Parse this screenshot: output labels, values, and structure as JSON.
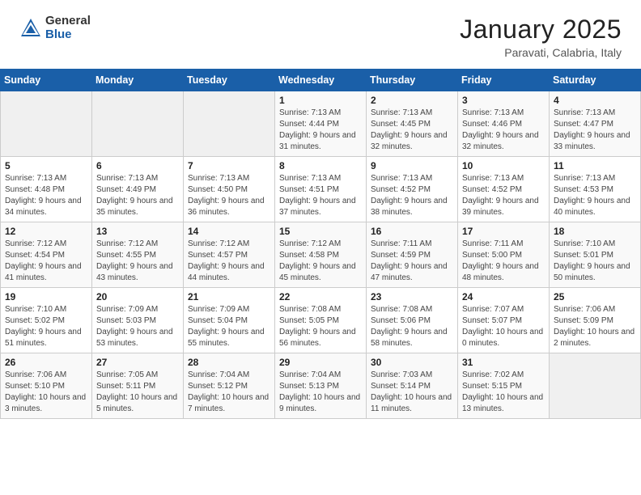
{
  "logo": {
    "general": "General",
    "blue": "Blue"
  },
  "header": {
    "title": "January 2025",
    "subtitle": "Paravati, Calabria, Italy"
  },
  "weekdays": [
    "Sunday",
    "Monday",
    "Tuesday",
    "Wednesday",
    "Thursday",
    "Friday",
    "Saturday"
  ],
  "weeks": [
    [
      {
        "day": "",
        "info": ""
      },
      {
        "day": "",
        "info": ""
      },
      {
        "day": "",
        "info": ""
      },
      {
        "day": "1",
        "info": "Sunrise: 7:13 AM\nSunset: 4:44 PM\nDaylight: 9 hours and 31 minutes."
      },
      {
        "day": "2",
        "info": "Sunrise: 7:13 AM\nSunset: 4:45 PM\nDaylight: 9 hours and 32 minutes."
      },
      {
        "day": "3",
        "info": "Sunrise: 7:13 AM\nSunset: 4:46 PM\nDaylight: 9 hours and 32 minutes."
      },
      {
        "day": "4",
        "info": "Sunrise: 7:13 AM\nSunset: 4:47 PM\nDaylight: 9 hours and 33 minutes."
      }
    ],
    [
      {
        "day": "5",
        "info": "Sunrise: 7:13 AM\nSunset: 4:48 PM\nDaylight: 9 hours and 34 minutes."
      },
      {
        "day": "6",
        "info": "Sunrise: 7:13 AM\nSunset: 4:49 PM\nDaylight: 9 hours and 35 minutes."
      },
      {
        "day": "7",
        "info": "Sunrise: 7:13 AM\nSunset: 4:50 PM\nDaylight: 9 hours and 36 minutes."
      },
      {
        "day": "8",
        "info": "Sunrise: 7:13 AM\nSunset: 4:51 PM\nDaylight: 9 hours and 37 minutes."
      },
      {
        "day": "9",
        "info": "Sunrise: 7:13 AM\nSunset: 4:52 PM\nDaylight: 9 hours and 38 minutes."
      },
      {
        "day": "10",
        "info": "Sunrise: 7:13 AM\nSunset: 4:52 PM\nDaylight: 9 hours and 39 minutes."
      },
      {
        "day": "11",
        "info": "Sunrise: 7:13 AM\nSunset: 4:53 PM\nDaylight: 9 hours and 40 minutes."
      }
    ],
    [
      {
        "day": "12",
        "info": "Sunrise: 7:12 AM\nSunset: 4:54 PM\nDaylight: 9 hours and 41 minutes."
      },
      {
        "day": "13",
        "info": "Sunrise: 7:12 AM\nSunset: 4:55 PM\nDaylight: 9 hours and 43 minutes."
      },
      {
        "day": "14",
        "info": "Sunrise: 7:12 AM\nSunset: 4:57 PM\nDaylight: 9 hours and 44 minutes."
      },
      {
        "day": "15",
        "info": "Sunrise: 7:12 AM\nSunset: 4:58 PM\nDaylight: 9 hours and 45 minutes."
      },
      {
        "day": "16",
        "info": "Sunrise: 7:11 AM\nSunset: 4:59 PM\nDaylight: 9 hours and 47 minutes."
      },
      {
        "day": "17",
        "info": "Sunrise: 7:11 AM\nSunset: 5:00 PM\nDaylight: 9 hours and 48 minutes."
      },
      {
        "day": "18",
        "info": "Sunrise: 7:10 AM\nSunset: 5:01 PM\nDaylight: 9 hours and 50 minutes."
      }
    ],
    [
      {
        "day": "19",
        "info": "Sunrise: 7:10 AM\nSunset: 5:02 PM\nDaylight: 9 hours and 51 minutes."
      },
      {
        "day": "20",
        "info": "Sunrise: 7:09 AM\nSunset: 5:03 PM\nDaylight: 9 hours and 53 minutes."
      },
      {
        "day": "21",
        "info": "Sunrise: 7:09 AM\nSunset: 5:04 PM\nDaylight: 9 hours and 55 minutes."
      },
      {
        "day": "22",
        "info": "Sunrise: 7:08 AM\nSunset: 5:05 PM\nDaylight: 9 hours and 56 minutes."
      },
      {
        "day": "23",
        "info": "Sunrise: 7:08 AM\nSunset: 5:06 PM\nDaylight: 9 hours and 58 minutes."
      },
      {
        "day": "24",
        "info": "Sunrise: 7:07 AM\nSunset: 5:07 PM\nDaylight: 10 hours and 0 minutes."
      },
      {
        "day": "25",
        "info": "Sunrise: 7:06 AM\nSunset: 5:09 PM\nDaylight: 10 hours and 2 minutes."
      }
    ],
    [
      {
        "day": "26",
        "info": "Sunrise: 7:06 AM\nSunset: 5:10 PM\nDaylight: 10 hours and 3 minutes."
      },
      {
        "day": "27",
        "info": "Sunrise: 7:05 AM\nSunset: 5:11 PM\nDaylight: 10 hours and 5 minutes."
      },
      {
        "day": "28",
        "info": "Sunrise: 7:04 AM\nSunset: 5:12 PM\nDaylight: 10 hours and 7 minutes."
      },
      {
        "day": "29",
        "info": "Sunrise: 7:04 AM\nSunset: 5:13 PM\nDaylight: 10 hours and 9 minutes."
      },
      {
        "day": "30",
        "info": "Sunrise: 7:03 AM\nSunset: 5:14 PM\nDaylight: 10 hours and 11 minutes."
      },
      {
        "day": "31",
        "info": "Sunrise: 7:02 AM\nSunset: 5:15 PM\nDaylight: 10 hours and 13 minutes."
      },
      {
        "day": "",
        "info": ""
      }
    ]
  ]
}
